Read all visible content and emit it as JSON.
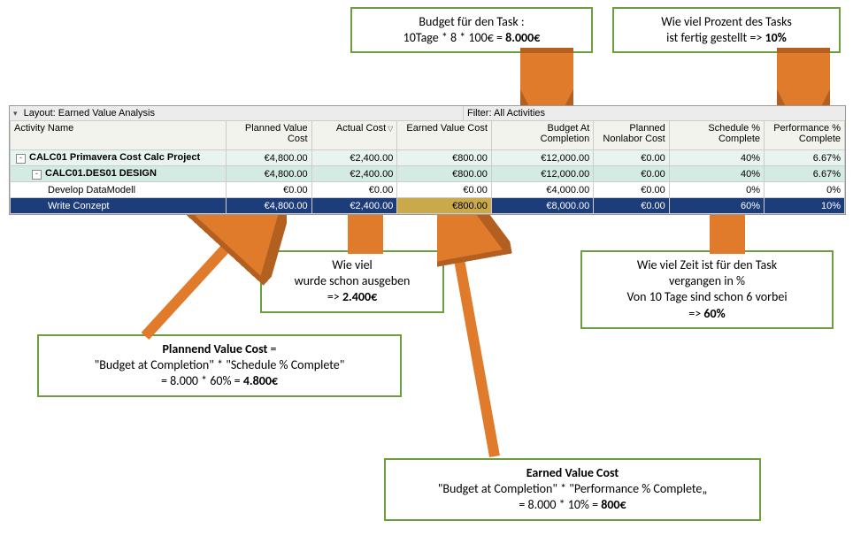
{
  "callouts": {
    "budget_task": {
      "line1": "Budget für den Task :",
      "line2_a": "10Tage * 8 * 100€ = ",
      "line2_b": "8.000€"
    },
    "percent_done": {
      "line1": "Wie viel Prozent des Tasks",
      "line2_a": "ist fertig gestellt   => ",
      "line2_b": "10%"
    },
    "spent": {
      "line1": "Wie viel",
      "line2": "wurde schon ausgeben",
      "line3_a": "=> ",
      "line3_b": "2.400€"
    },
    "time_elapsed": {
      "line1": "Wie viel Zeit ist für den Task",
      "line2": "vergangen in %",
      "line3": "Von 10 Tage sind schon 6 vorbei",
      "line4_a": "=> ",
      "line4_b": "60%"
    },
    "pv_cost": {
      "line1_a": "Plannend Value Cost",
      "line1_b": " =",
      "line2": "\"Budget at Completion\" * \"Schedule % Complete\"",
      "line3_a": "= 8.000 * 60% = ",
      "line3_b": "4.800€"
    },
    "ev_cost": {
      "line1": "Earned Value Cost",
      "line2": "\"Budget at Completion\" * \"Performance % Complete„",
      "line3_a": "= 8.000 * 10% = ",
      "line3_b": "800€"
    }
  },
  "filter_bar": {
    "layout_label": "Layout: Earned Value Analysis",
    "filter_label": "Filter: All Activities"
  },
  "columns": {
    "activity_name": "Activity Name",
    "pv_cost": "Planned Value Cost",
    "actual_cost": "Actual Cost",
    "ev_cost": "Earned Value Cost",
    "bac": "Budget At Completion",
    "nonlabor": "Planned Nonlabor Cost",
    "sched_pct": "Schedule % Complete",
    "perf_pct": "Performance % Complete"
  },
  "rows": [
    {
      "level": 0,
      "name_prefix": "CALC01",
      "name": "  Primavera Cost Calc Project",
      "pv": "€4,800.00",
      "ac": "€2,400.00",
      "ev": "€800.00",
      "bac": "€12,000.00",
      "nl": "€0.00",
      "spc": "40%",
      "ppc": "6.67%"
    },
    {
      "level": 1,
      "name_prefix": "CALC01.DES01",
      "name": "  DESIGN",
      "pv": "€4,800.00",
      "ac": "€2,400.00",
      "ev": "€800.00",
      "bac": "€12,000.00",
      "nl": "€0.00",
      "spc": "40%",
      "ppc": "6.67%"
    },
    {
      "level": 2,
      "name_prefix": "",
      "name": "Develop DataModell",
      "pv": "€0.00",
      "ac": "€0.00",
      "ev": "€0.00",
      "bac": "€4,000.00",
      "nl": "€0.00",
      "spc": "0%",
      "ppc": "0%"
    },
    {
      "level": 2,
      "selected": true,
      "name_prefix": "",
      "name": "Write Conzept",
      "pv": "€4,800.00",
      "ac": "€2,400.00",
      "ev": "€800.00",
      "bac": "€8,000.00",
      "nl": "€0.00",
      "spc": "60%",
      "ppc": "10%",
      "highlight_col": "ev"
    }
  ]
}
